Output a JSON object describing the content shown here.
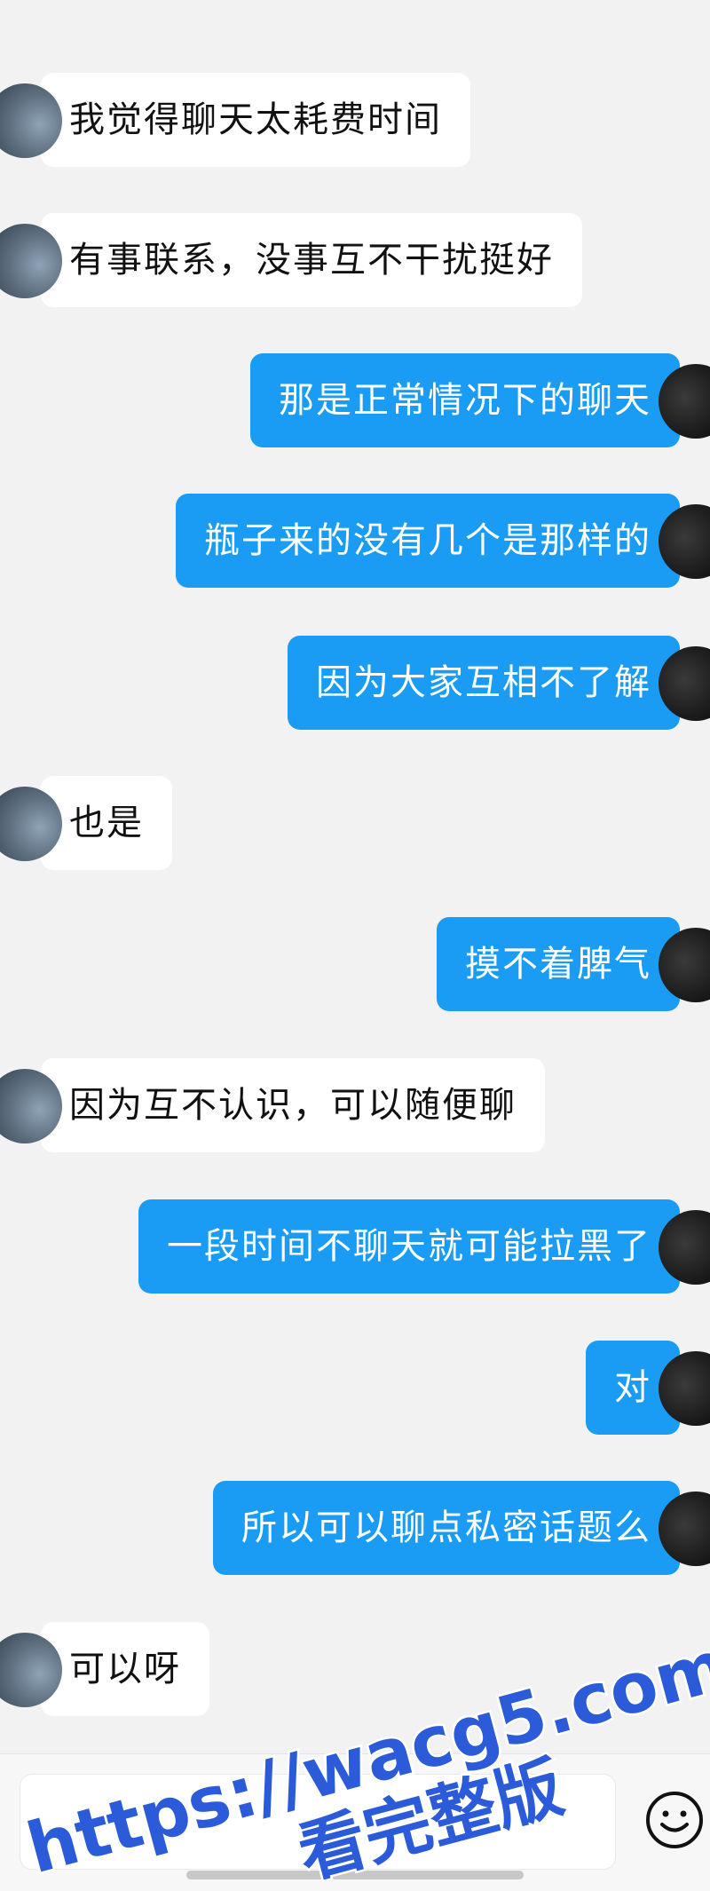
{
  "messages": [
    {
      "side": "in",
      "text": "我觉得聊天太耗费时间"
    },
    {
      "side": "in",
      "text": "有事联系，没事互不干扰挺好"
    },
    {
      "side": "out",
      "text": "那是正常情况下的聊天"
    },
    {
      "side": "out",
      "text": "瓶子来的没有几个是那样的"
    },
    {
      "side": "out",
      "text": "因为大家互相不了解"
    },
    {
      "side": "in",
      "text": "也是"
    },
    {
      "side": "out",
      "text": "摸不着脾气"
    },
    {
      "side": "in",
      "text": "因为互不认识，可以随便聊"
    },
    {
      "side": "out",
      "text": "一段时间不聊天就可能拉黑了"
    },
    {
      "side": "out",
      "text": "对"
    },
    {
      "side": "out",
      "text": "所以可以聊点私密话题么"
    },
    {
      "side": "in",
      "text": "可以呀"
    }
  ],
  "input_bar": {
    "emoji_icon": "smiley-face-icon",
    "input_value": ""
  },
  "watermark": {
    "url": "https://wacg5.com",
    "caption": "看完整版"
  },
  "colors": {
    "incoming_bubble": "#ffffff",
    "outgoing_bubble": "#1a9cf5",
    "background": "#f2f2f2",
    "watermark": "#2b5bd8"
  }
}
